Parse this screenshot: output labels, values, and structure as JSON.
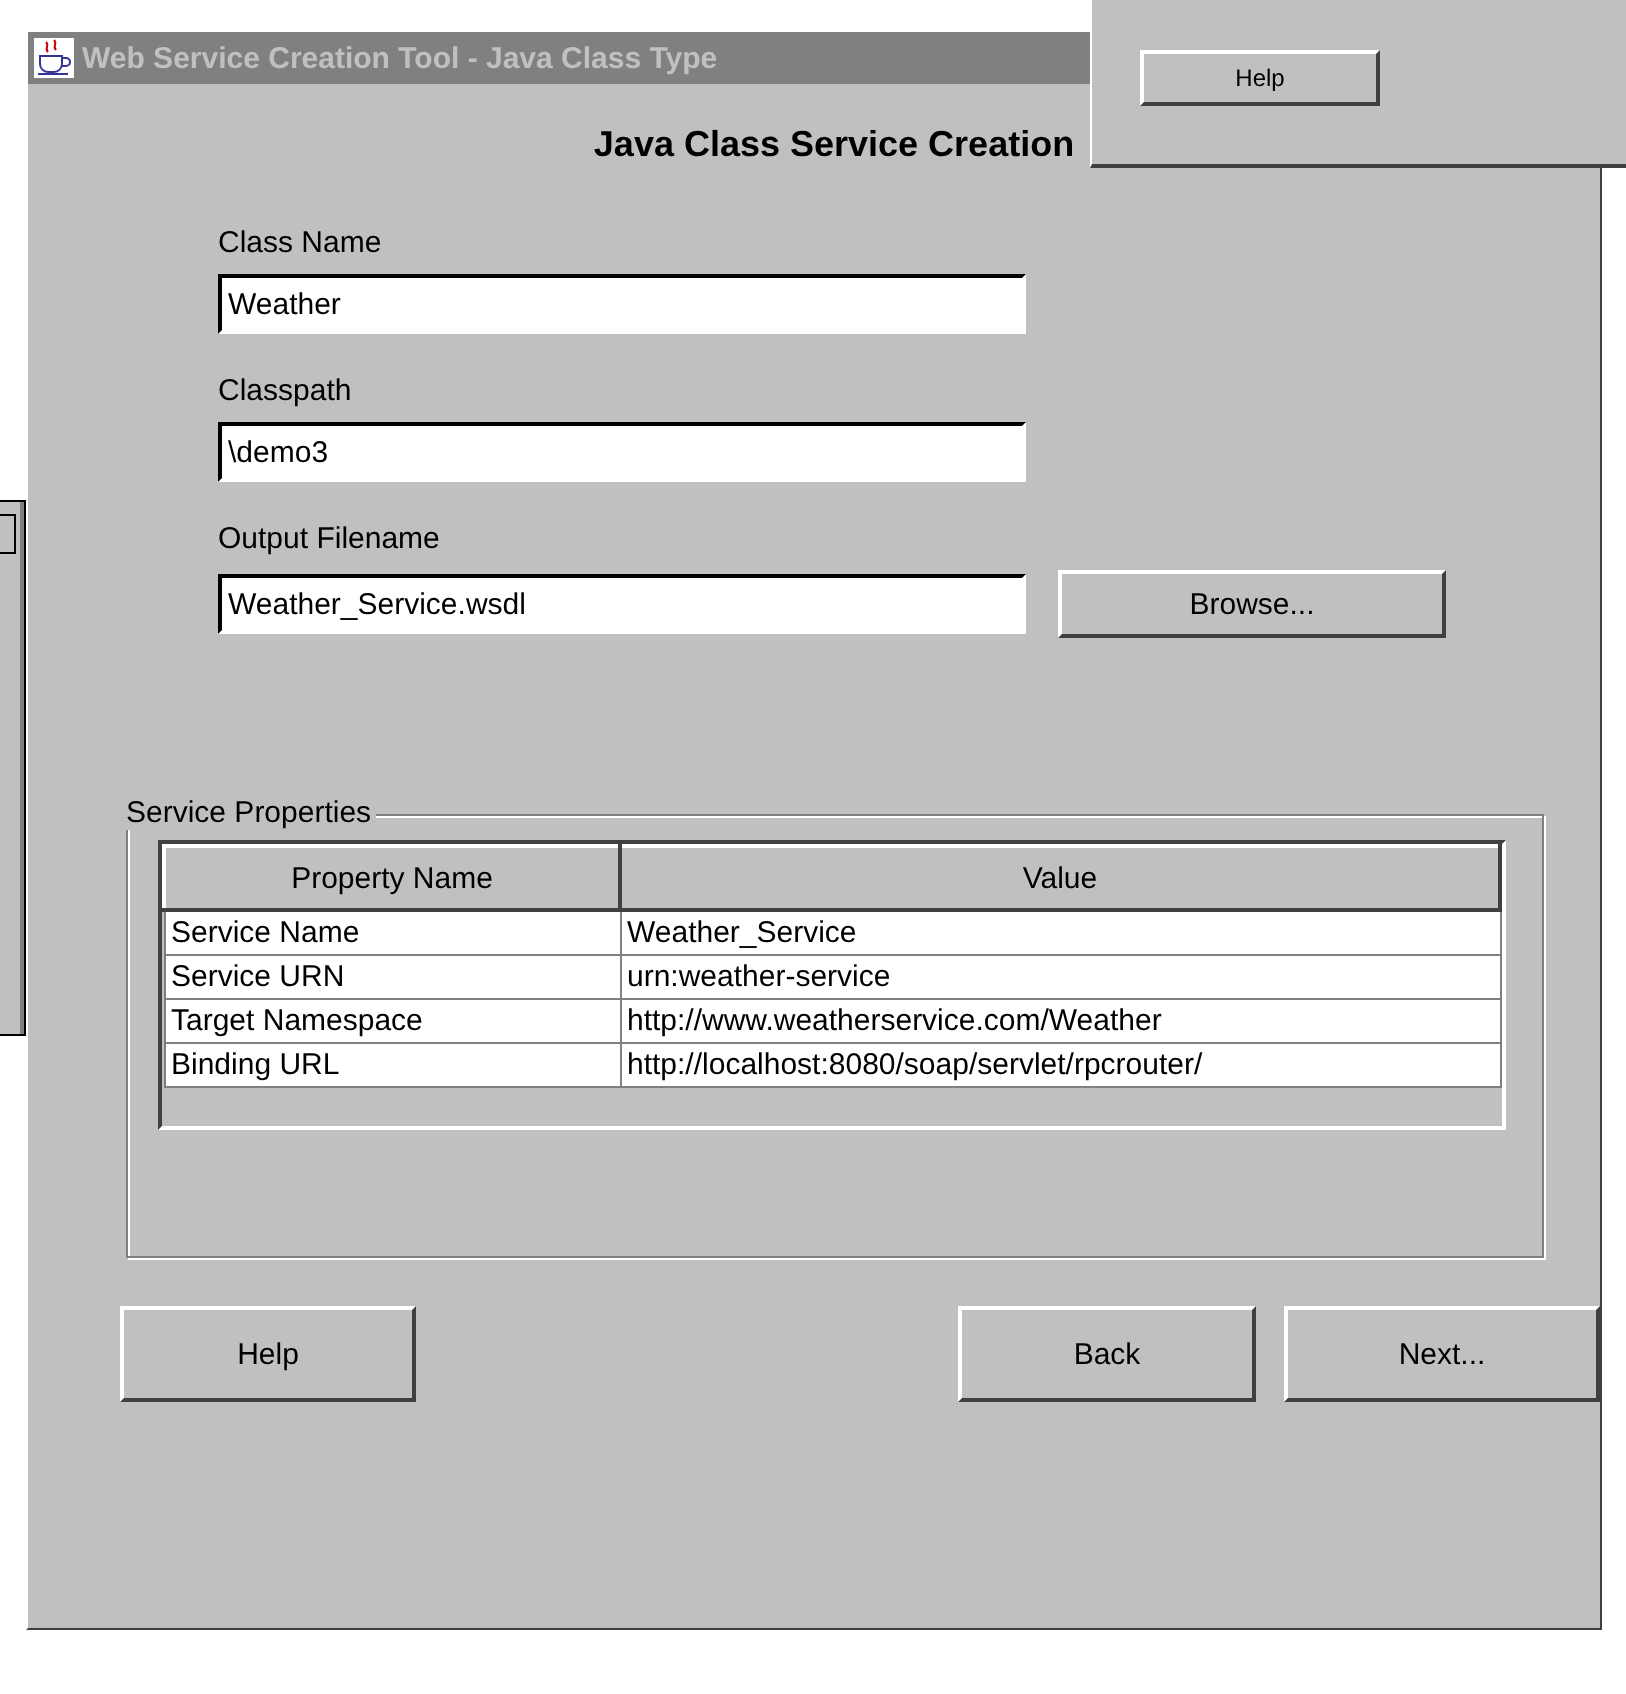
{
  "window": {
    "title": "Web Service Creation Tool - Java Class Type",
    "active": false
  },
  "background_window": {
    "buttons": [
      "Help"
    ]
  },
  "heading": "Java Class Service Creation",
  "fields": [
    {
      "label": "Class Name",
      "value": "Weather"
    },
    {
      "label": "Classpath",
      "value": "\\demo3"
    },
    {
      "label": "Output Filename",
      "value": "Weather_Service.wsdl",
      "button": "Browse..."
    }
  ],
  "service_properties": {
    "title": "Service Properties",
    "columns": [
      "Property Name",
      "Value"
    ],
    "rows": [
      [
        "Service Name",
        "Weather_Service"
      ],
      [
        "Service URN",
        "urn:weather-service"
      ],
      [
        "Target Namespace",
        "http://www.weatherservice.com/Weather"
      ],
      [
        "Binding URL",
        "http://localhost:8080/soap/servlet/rpcrouter/"
      ]
    ]
  },
  "buttons": {
    "left": [
      "Help"
    ],
    "right": [
      "Back",
      "Next..."
    ]
  }
}
